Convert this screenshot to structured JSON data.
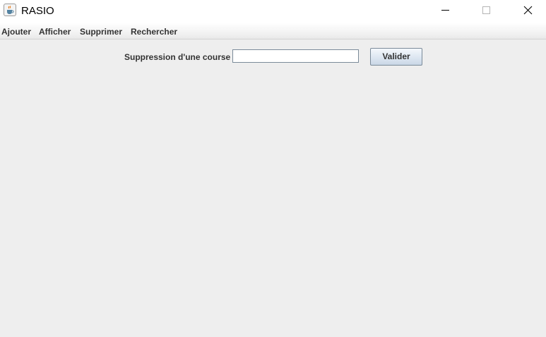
{
  "window": {
    "title": "RASIO",
    "controls": {
      "minimize_icon": "minimize-icon",
      "maximize_icon": "maximize-icon",
      "close_icon": "close-icon"
    },
    "app_icon": "java-cup-icon"
  },
  "menubar": {
    "items": [
      {
        "label": "Ajouter"
      },
      {
        "label": "Afficher"
      },
      {
        "label": "Supprimer"
      },
      {
        "label": "Rechercher"
      }
    ]
  },
  "form": {
    "label": "Suppression d'une course",
    "input_value": "",
    "submit_label": "Valider"
  },
  "colors": {
    "background": "#eeeeee",
    "titlebar": "#ffffff",
    "button_gradient_top": "#f4f8fc",
    "button_gradient_bottom": "#c9d7e6",
    "border": "#7a8a99"
  }
}
